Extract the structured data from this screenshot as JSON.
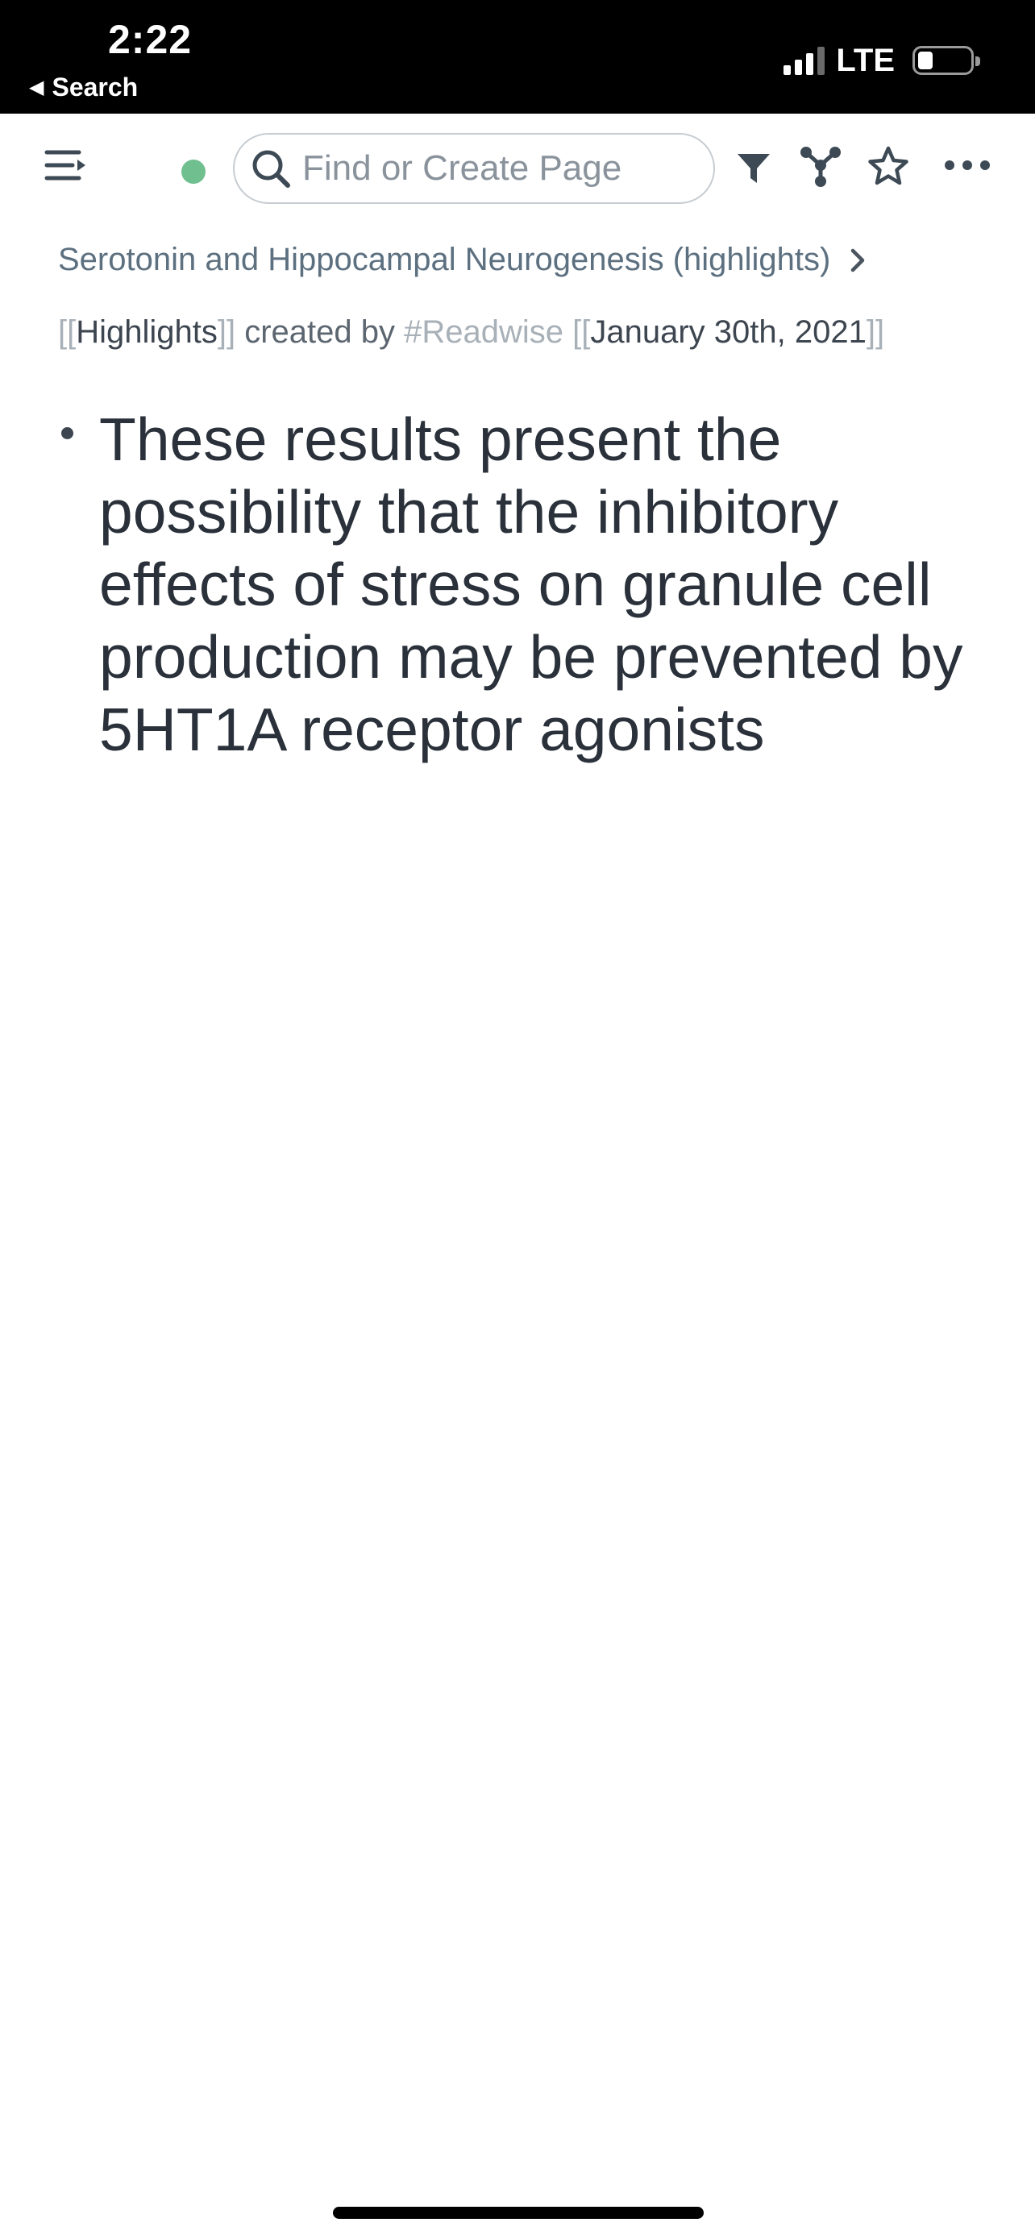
{
  "status_bar": {
    "time": "2:22",
    "back_label": "Search",
    "network": "LTE",
    "signal_bars_active": 3,
    "signal_bars_total": 4
  },
  "toolbar": {
    "search_placeholder": "Find or Create Page",
    "sync_color": "#6fbf8f",
    "icons": [
      "menu-icon",
      "search-icon",
      "filter-icon",
      "graph-icon",
      "star-icon",
      "more-icon"
    ]
  },
  "page": {
    "title": "Serotonin and Hippocampal Neurogenesis (highlights)",
    "meta": {
      "open_bracket_1": "[[",
      "highlights_ref": "Highlights",
      "close_bracket_1": "]]",
      "created_by": " created by ",
      "readwise_tag": "#Readwise",
      "open_bracket_2": " [[",
      "date_ref": "January 30th, 2021",
      "close_bracket_2": "]]"
    },
    "blocks": [
      {
        "text": "These results present the possibility that the inhibitory effects of stress on granule cell production may be prevented by 5HT1A receptor agonists"
      }
    ]
  }
}
